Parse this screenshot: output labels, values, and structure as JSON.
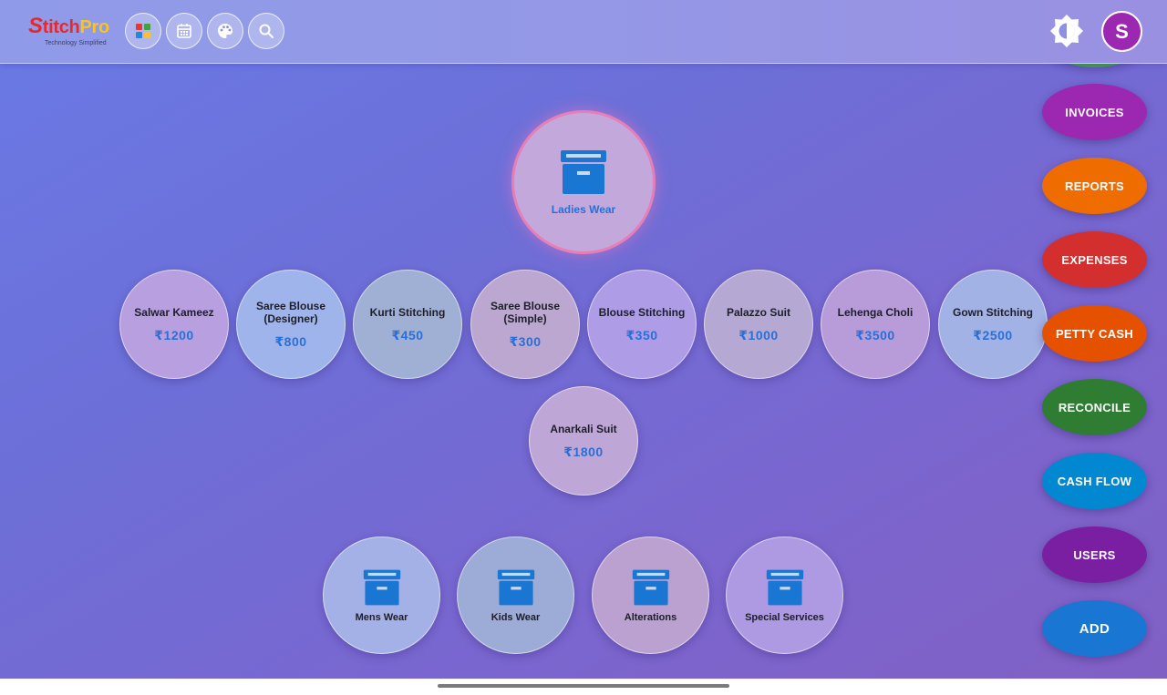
{
  "app": {
    "logo_main_s": "S",
    "logo_main_titch": "titch",
    "logo_main_pro": "Pro",
    "logo_tagline": "Technology Simplified",
    "user_initial": "S"
  },
  "toolbar": {
    "icons": [
      "apps-grid-icon",
      "calendar-icon",
      "palette-icon",
      "search-icon"
    ],
    "theme_icon": "brightness-icon"
  },
  "main_category": {
    "label": "Ladies Wear",
    "icon": "archive-box-icon"
  },
  "services": [
    {
      "name": "Salwar Kameez",
      "price": "₹1200"
    },
    {
      "name": "Saree Blouse (Designer)",
      "price": "₹800"
    },
    {
      "name": "Kurti Stitching",
      "price": "₹450"
    },
    {
      "name": "Saree Blouse (Simple)",
      "price": "₹300"
    },
    {
      "name": "Blouse Stitching",
      "price": "₹350"
    },
    {
      "name": "Palazzo Suit",
      "price": "₹1000"
    },
    {
      "name": "Lehenga Choli",
      "price": "₹3500"
    },
    {
      "name": "Gown Stitching",
      "price": "₹2500"
    },
    {
      "name": "Anarkali Suit",
      "price": "₹1800"
    }
  ],
  "categories": [
    {
      "label": "Mens Wear",
      "icon": "archive-box-icon"
    },
    {
      "label": "Kids Wear",
      "icon": "archive-box-icon"
    },
    {
      "label": "Alterations",
      "icon": "archive-box-icon"
    },
    {
      "label": "Special Services",
      "icon": "archive-box-icon"
    }
  ],
  "side_menu": [
    {
      "label": "INVOICES",
      "color": "#9c27b0"
    },
    {
      "label": "REPORTS",
      "color": "#ef6c00"
    },
    {
      "label": "EXPENSES",
      "color": "#d32f2f"
    },
    {
      "label": "PETTY CASH",
      "color": "#e65100"
    },
    {
      "label": "RECONCILE",
      "color": "#2e7d32"
    },
    {
      "label": "CASH FLOW",
      "color": "#0288d1"
    },
    {
      "label": "USERS",
      "color": "#7b1fa2"
    },
    {
      "label": "ADD",
      "color": "#1976d2"
    }
  ],
  "colors": {
    "accent_blue": "#2a6fd6",
    "avatar": "#9c27b0",
    "background_start": "#6a7ae6",
    "background_end": "#8160c4"
  }
}
